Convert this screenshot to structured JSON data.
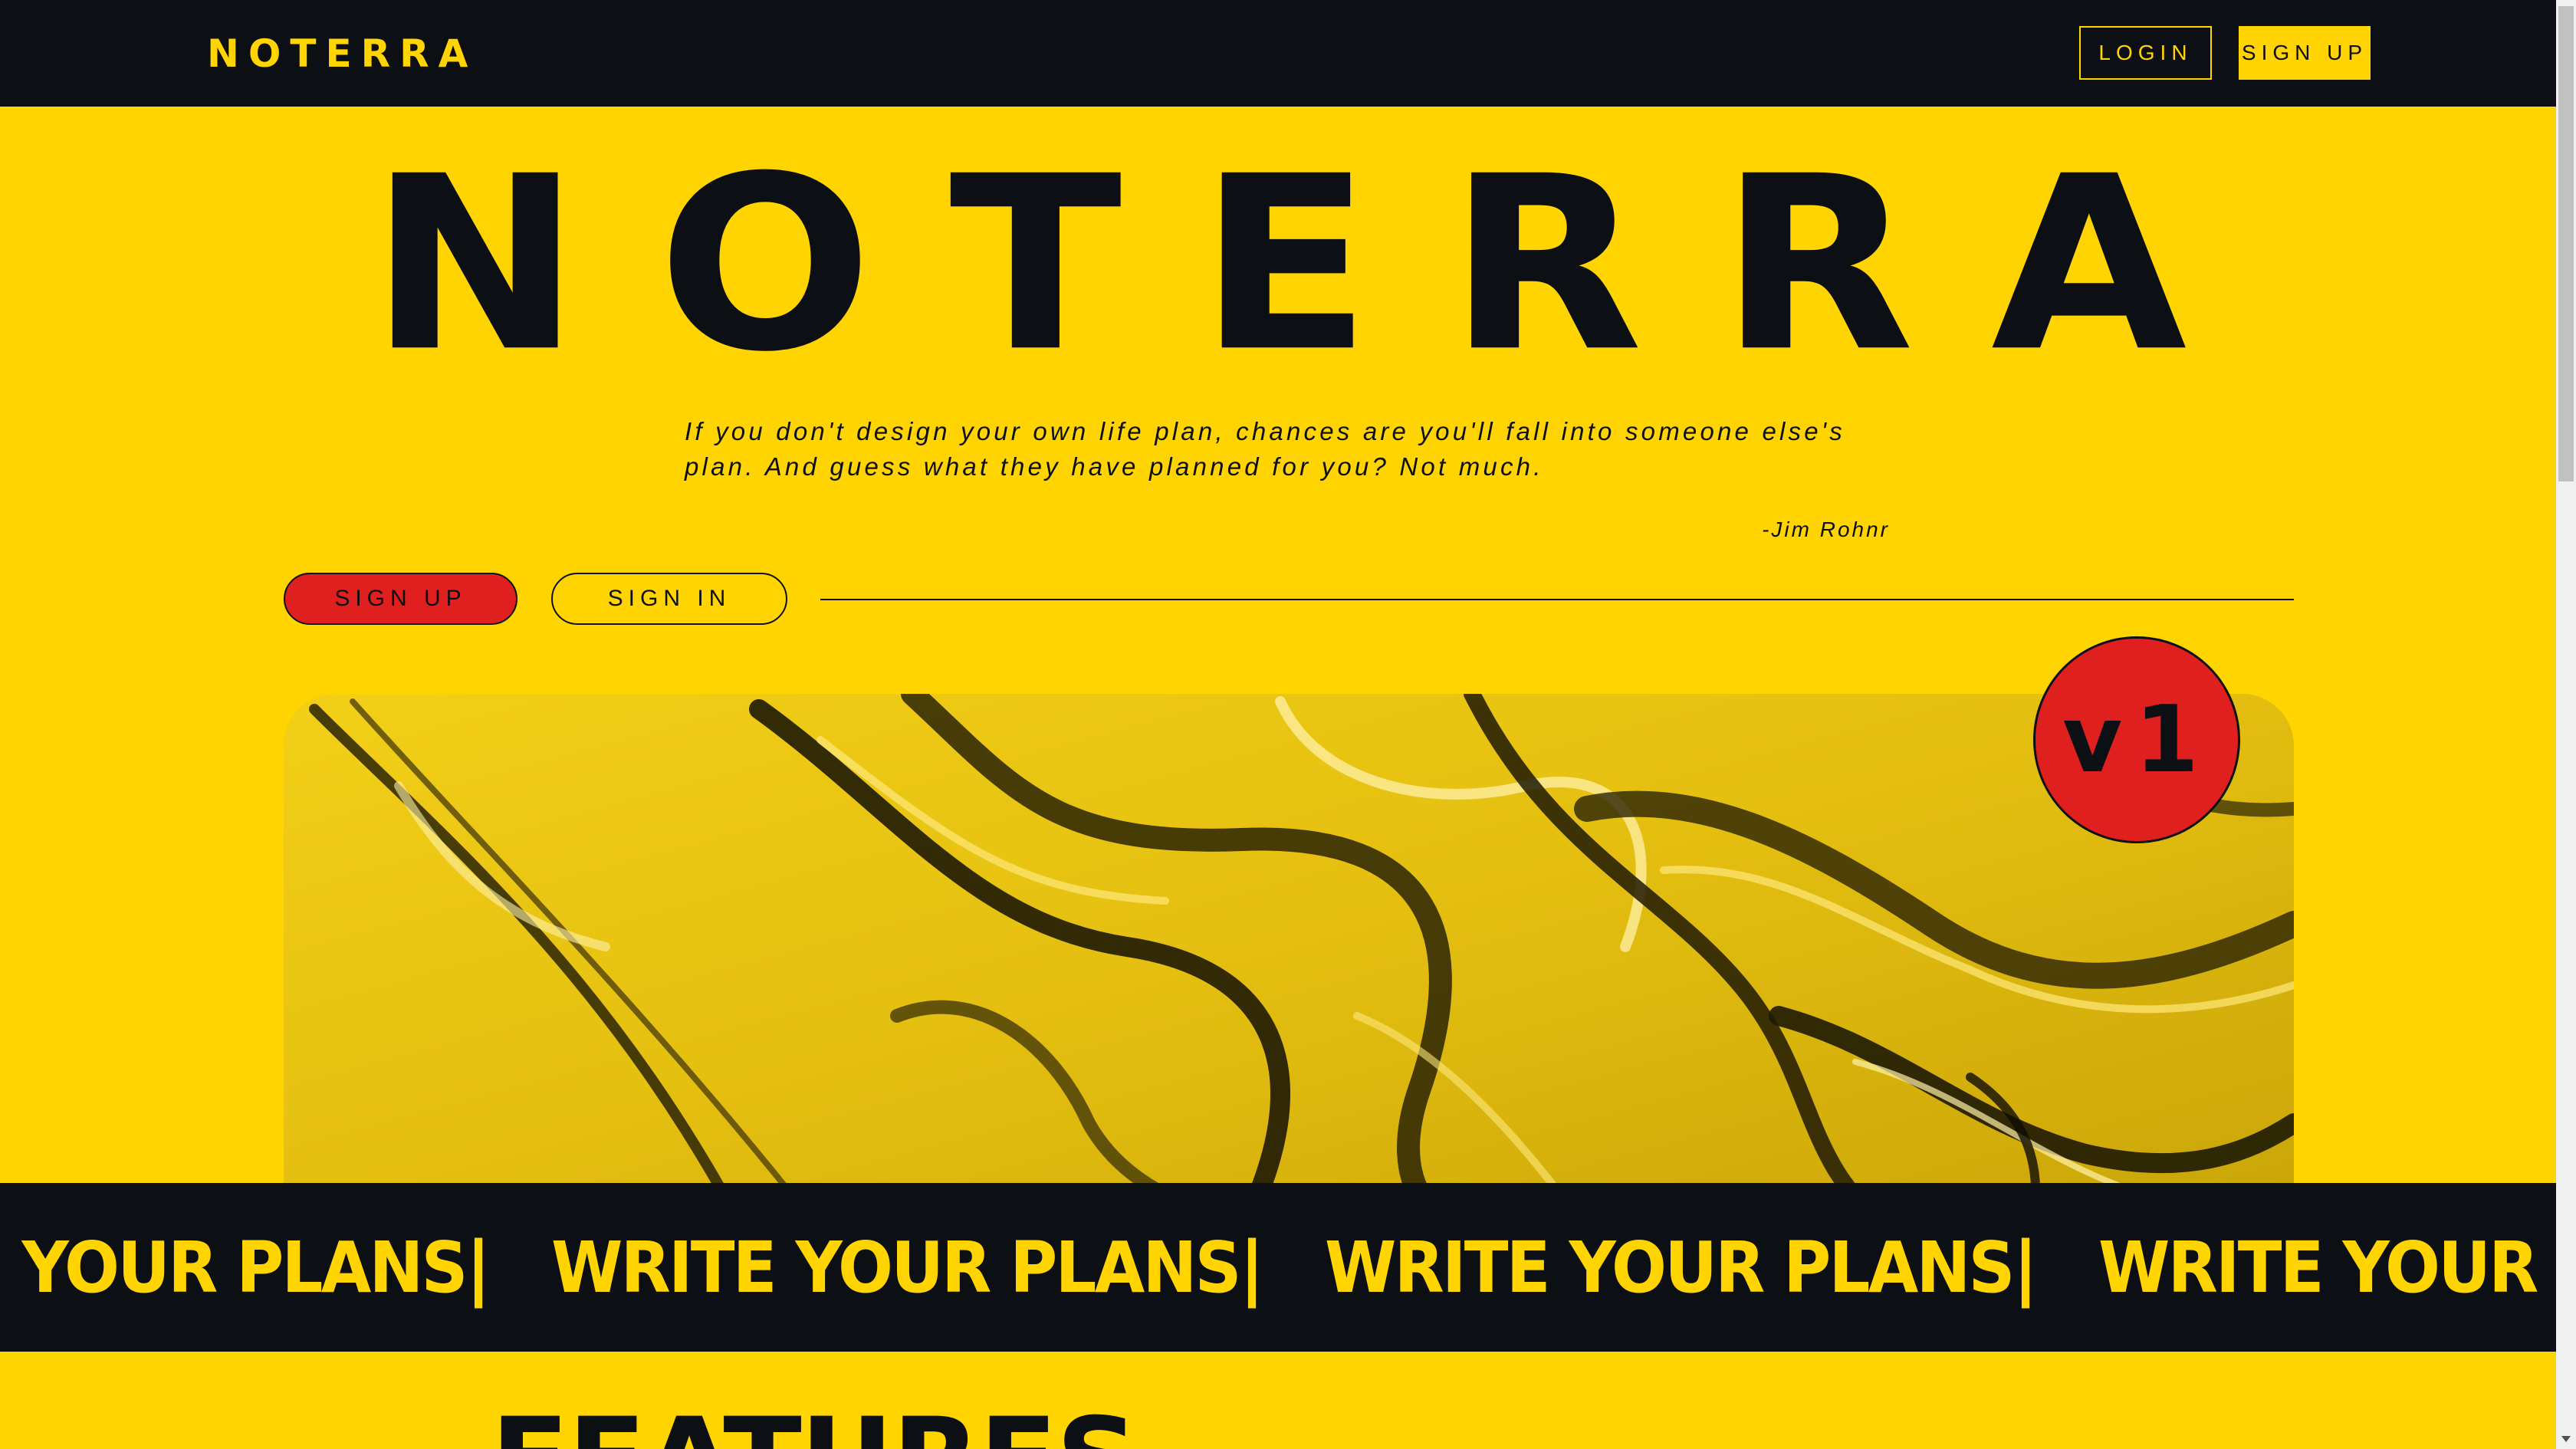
{
  "nav": {
    "brand": "NOTERRA",
    "login_label": "LOGIN",
    "signup_label": "SIGN UP"
  },
  "hero": {
    "title": "NOTERRA",
    "quote": "If you don't design your own life plan, chances are you'll fall into someone else's plan. And guess what they have planned for you? Not much.",
    "author": "-Jim Rohnr",
    "signup_label": "SIGN UP",
    "signin_label": "SIGN IN"
  },
  "banner": {
    "badge": "v1"
  },
  "marquee": {
    "items": [
      "WRITE YOUR PLANS",
      "WRITE YOUR PLANS",
      "WRITE YOUR PLANS",
      "WRITE YOUR PLANS"
    ],
    "separator": "|"
  },
  "features": {
    "title": "FEATURES"
  },
  "colors": {
    "accent": "#FFD400",
    "dark": "#0C1014",
    "red": "#E01F1F"
  }
}
